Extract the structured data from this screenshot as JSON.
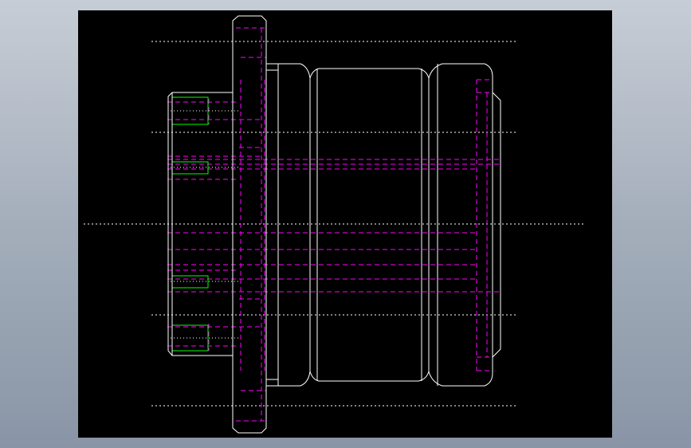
{
  "drawing": {
    "background": "#000000",
    "colors": {
      "outline": "#ffffff",
      "hidden_lines": "#ff00ff",
      "threads": "#00ff00",
      "centerlines": "#ffffff"
    }
  }
}
